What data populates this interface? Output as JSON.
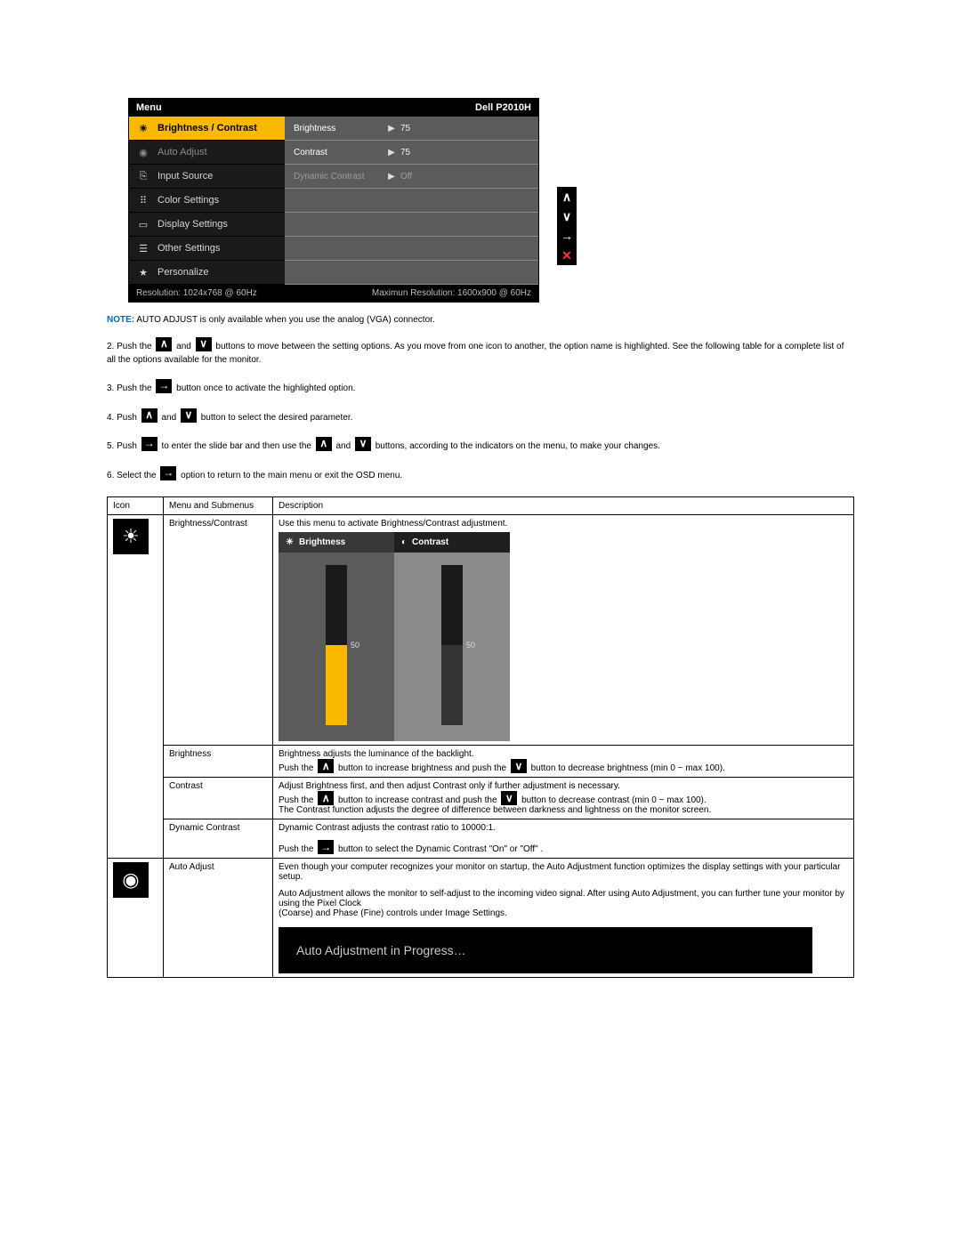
{
  "osd": {
    "title": "Menu",
    "model": "Dell P2010H",
    "left_items": [
      {
        "icon": "sun",
        "label": "Brightness / Contrast",
        "selected": true
      },
      {
        "icon": "target",
        "label": "Auto Adjust",
        "dim": true
      },
      {
        "icon": "input",
        "label": "Input Source"
      },
      {
        "icon": "dots",
        "label": "Color Settings"
      },
      {
        "icon": "screen",
        "label": "Display Settings"
      },
      {
        "icon": "sliders",
        "label": "Other Settings"
      },
      {
        "icon": "star",
        "label": "Personalize"
      }
    ],
    "right_rows": [
      {
        "label": "Brightness",
        "arrow": "▶",
        "value": "75"
      },
      {
        "label": "Contrast",
        "arrow": "▶",
        "value": "75"
      },
      {
        "label": "Dynamic Contrast",
        "arrow": "▶",
        "value": "Off",
        "dim": true
      }
    ],
    "footer_left": "Resolution: 1024x768 @ 60Hz",
    "footer_right": "Maximun Resolution: 1600x900 @ 60Hz"
  },
  "side_buttons": [
    "∧",
    "∨",
    "→",
    "✕"
  ],
  "note": {
    "label": "NOTE:",
    "text": "AUTO ADJUST is only available when you use the analog (VGA) connector."
  },
  "steps": {
    "s2_a": "2. Push the ",
    "s2_b": " and ",
    "s2_c": " buttons to move between the setting options. As you move from one icon to another, the option name is highlighted. See the following table for a complete list of all the options available for the monitor.",
    "s3_a": "3. Push the ",
    "s3_b": " button once to activate the highlighted option.",
    "s4_a": "4. Push ",
    "s4_b": " and ",
    "s4_c": " button to select the desired parameter.",
    "s5_a": "5. Push ",
    "s5_b": " to enter the slide bar and then use the ",
    "s5_c": " and ",
    "s5_d": " buttons, according to the indicators on the menu, to make your changes.",
    "s6_a": "6. Select the ",
    "s6_b": " option to return to the main menu or exit the OSD menu."
  },
  "table": {
    "headers": {
      "icon": "Icon",
      "menu": "Menu and Submenus",
      "desc": "Description"
    },
    "bc": {
      "name": "Brightness/Contrast",
      "desc": "Use this menu to activate Brightness/Contrast adjustment.",
      "col_brightness": "Brightness",
      "col_contrast": "Contrast",
      "val_brightness": "50",
      "val_contrast": "50"
    },
    "brightness": {
      "name": "Brightness",
      "line1": "Brightness adjusts the luminance of the backlight.",
      "line_a": "Push the ",
      "line_b": " button to increase brightness and push the ",
      "line_c": " button to decrease brightness (min 0 ~ max 100)."
    },
    "contrast": {
      "name": "Contrast",
      "line1": "Adjust Brightness first, and then adjust Contrast only if further adjustment is necessary.",
      "line_a": "Push the ",
      "line_b": " button to increase contrast and push the ",
      "line_c": " button to decrease contrast (min 0 ~ max 100).",
      "line2": "The Contrast function adjusts the degree of difference between darkness and lightness on the monitor screen."
    },
    "dyn": {
      "name": "Dynamic Contrast",
      "line1": "Dynamic Contrast adjusts the contrast ratio to 10000:1.",
      "line_a": "Push the ",
      "line_b": " button to select the Dynamic Contrast \"On\" or \"Off\" ."
    },
    "auto": {
      "name": "Auto Adjust",
      "p1": "Even though your computer recognizes your monitor on startup, the Auto Adjustment function optimizes the display settings with your particular setup.",
      "p2": "Auto Adjustment allows the monitor to self-adjust to the incoming video signal. After using Auto Adjustment, you can further tune your monitor by using the Pixel Clock",
      "p3": "(Coarse) and Phase (Fine) controls under Image Settings.",
      "progress": "Auto Adjustment in Progress…"
    }
  }
}
